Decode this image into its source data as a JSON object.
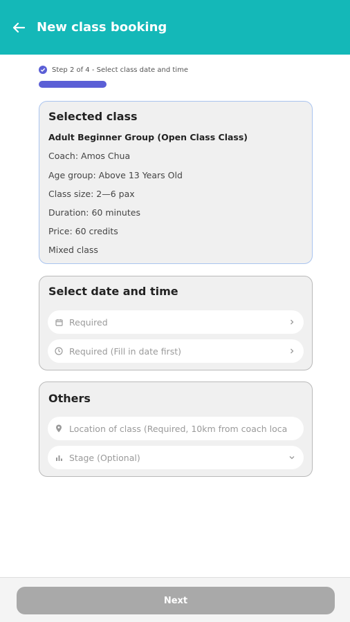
{
  "header": {
    "title": "New class booking"
  },
  "stepper": {
    "text": "Step 2 of 4 - Select class date and time",
    "progress": 0.5
  },
  "selected_class": {
    "heading": "Selected class",
    "name": "Adult Beginner Group (Open Class Class)",
    "coach": "Coach: Amos  Chua",
    "age_group": "Age group: Above 13 Years Old",
    "class_size": "Class size: 2—6 pax",
    "duration": "Duration: 60 minutes",
    "price": "Price: 60 credits",
    "type": "Mixed class"
  },
  "date_time": {
    "heading": "Select date and time",
    "date_placeholder": "Required",
    "time_placeholder": "Required (Fill in date first)"
  },
  "others": {
    "heading": "Others",
    "location_placeholder": "Location of class (Required, 10km from coach loca",
    "stage_placeholder": "Stage (Optional)"
  },
  "footer": {
    "next_label": "Next"
  },
  "colors": {
    "header": "#14b8b8",
    "accent": "#5b5fd6",
    "button_disabled": "#a9a9a9"
  },
  "icons": [
    "back-arrow-icon",
    "check-circle-icon",
    "calendar-icon",
    "clock-icon",
    "location-pin-icon",
    "bar-chart-icon",
    "chevron-right-icon",
    "chevron-down-icon"
  ]
}
